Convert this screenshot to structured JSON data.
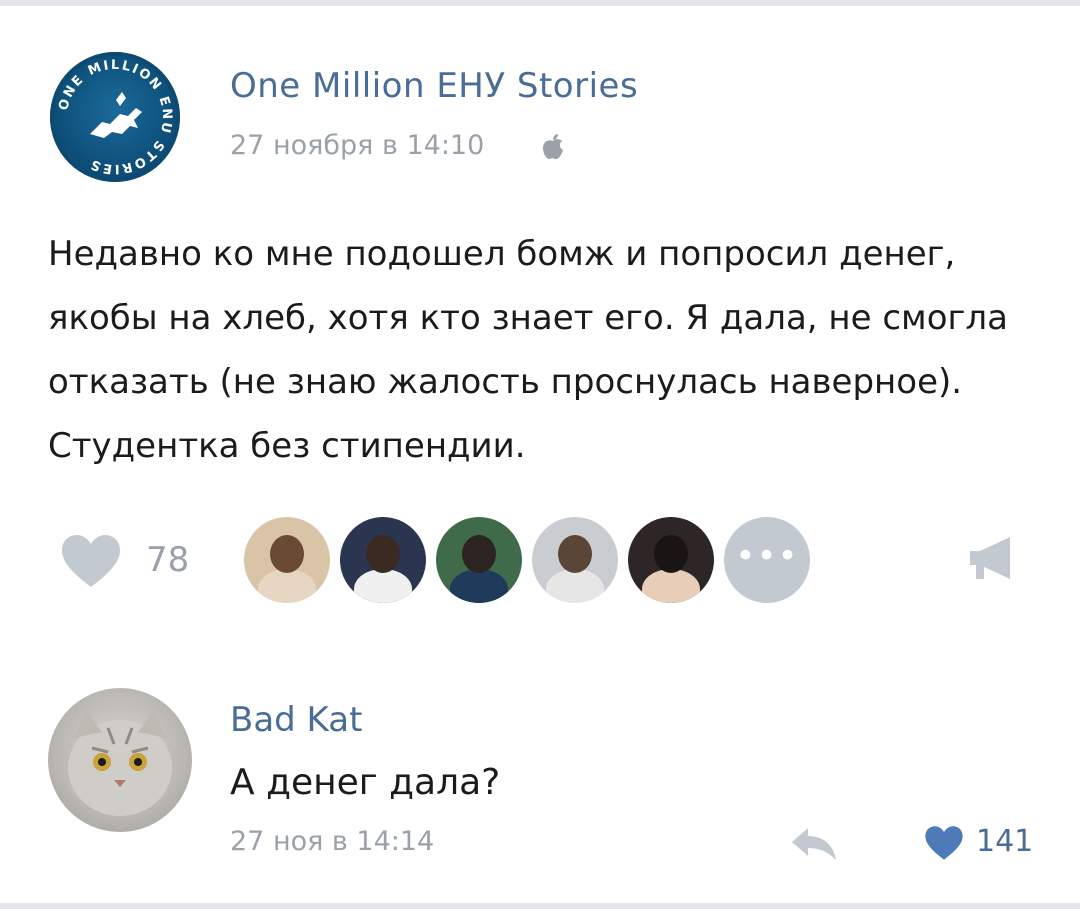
{
  "post": {
    "author": "One Million ЕНУ Stories",
    "date": "27 ноября в 14:10",
    "platform_icon": "apple-icon",
    "avatar_text": "ONE MILLION ENU STORIES",
    "text_lines": [
      "Недавно ко мне подошел бомж и попросил денег,",
      "якобы на хлеб, хотя кто знает его. Я дала, не смогла",
      "отказать (не знаю жалость проснулась наверное).",
      "Студентка без стипендии."
    ]
  },
  "likes": {
    "count": "78",
    "more_label": "•••",
    "liker_avatars": [
      {
        "name": "liker-avatar-1",
        "bg": "#d9c4a8",
        "head": "#6b4a33",
        "body": "#e6d6c2"
      },
      {
        "name": "liker-avatar-2",
        "bg": "#2a3550",
        "head": "#3a2a22",
        "body": "#f0f0f0"
      },
      {
        "name": "liker-avatar-3",
        "bg": "#3f6b4a",
        "head": "#2b2420",
        "body": "#1f3a5a"
      },
      {
        "name": "liker-avatar-4",
        "bg": "#c9cdd2",
        "head": "#5a4536",
        "body": "#e6e6e6"
      },
      {
        "name": "liker-avatar-5",
        "bg": "#2e2626",
        "head": "#1a1414",
        "body": "#e8cdb8"
      }
    ]
  },
  "comment": {
    "author": "Bad Kat",
    "text": "А денег дала?",
    "date": "27 ноя в 14:14",
    "like_count": "141"
  },
  "colors": {
    "link_blue": "#4a6d97",
    "muted_gray": "#9aa1a9",
    "heart_blue": "#4d7ab8"
  }
}
